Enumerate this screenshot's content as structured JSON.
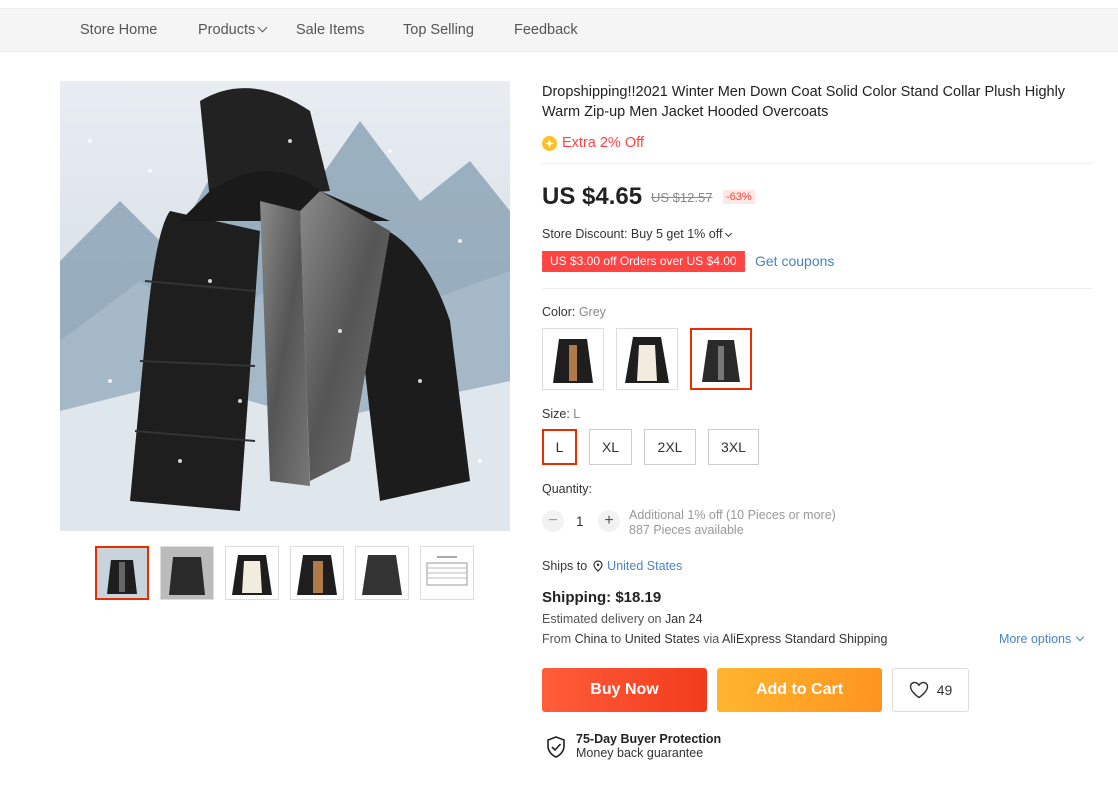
{
  "nav": {
    "items": [
      {
        "label": "Store Home"
      },
      {
        "label": "Products"
      },
      {
        "label": "Sale Items"
      },
      {
        "label": "Top Selling"
      },
      {
        "label": "Feedback"
      }
    ]
  },
  "product": {
    "title": "Dropshipping!!2021 Winter Men Down Coat Solid Color Stand Collar Plush Highly Warm Zip-up Men Jacket Hooded Overcoats",
    "extra_off": "Extra 2% Off",
    "price": "US $4.65",
    "original_price": "US $12.57",
    "discount_pct": "-63%",
    "store_discount": "Store Discount: Buy 5 get 1% off",
    "coupon": "US $3.00 off Orders over US $4.00",
    "get_coupons": "Get coupons",
    "color_label": "Color:",
    "color_value": "Grey",
    "size_label": "Size:",
    "size_value": "L",
    "sizes": [
      "L",
      "XL",
      "2XL",
      "3XL"
    ],
    "quantity_label": "Quantity:",
    "quantity": "1",
    "qty_minus": "−",
    "qty_plus": "+",
    "qty_info_1": "Additional 1% off (10 Pieces or more)",
    "qty_info_2": "887 Pieces available",
    "ships_to_label": "Ships to",
    "ships_to": "United States",
    "shipping": "Shipping: $18.19",
    "est_prefix": "Estimated delivery on",
    "est_date": "Jan 24",
    "from_word": "From",
    "from_origin": "China",
    "to_word": "to",
    "to_dest": "United States",
    "via_word": "via",
    "via_carrier": "AliExpress Standard Shipping",
    "more_options": "More options",
    "buy_now": "Buy Now",
    "add_to_cart": "Add to Cart",
    "wish_count": "49",
    "protection_title": "75-Day Buyer Protection",
    "protection_sub": "Money back guarantee"
  },
  "colors": {
    "accent": "#e62e04",
    "price_red": "#ff4747",
    "link": "#4a82c4",
    "buy": "#f23b1d",
    "cart": "#ff9420"
  }
}
